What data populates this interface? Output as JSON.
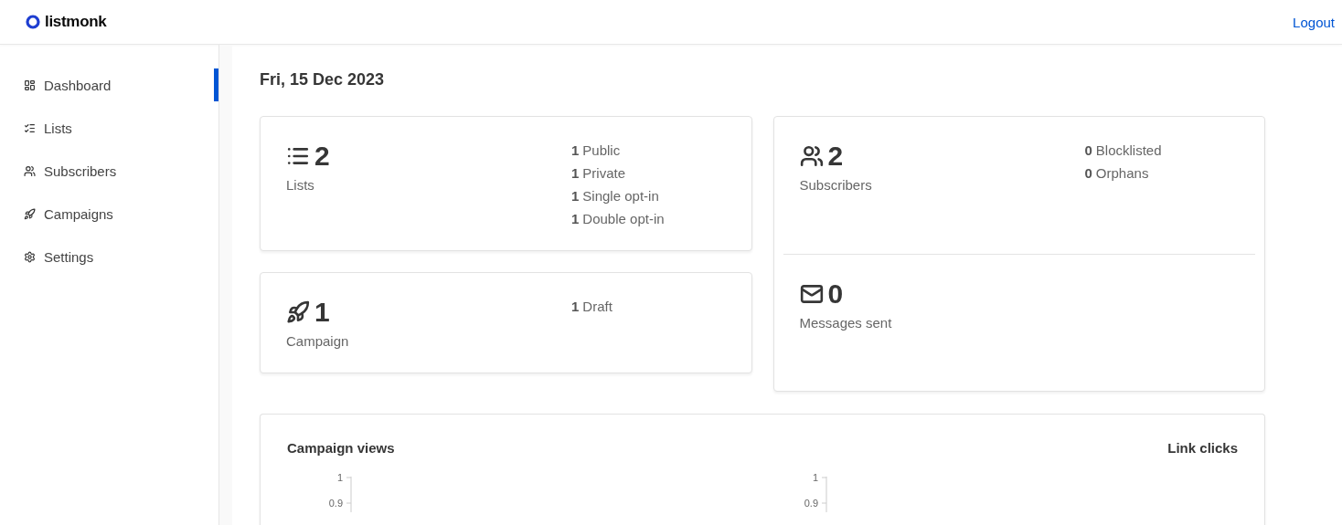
{
  "header": {
    "logo": "listmonk",
    "logout": "Logout"
  },
  "sidebar": {
    "items": [
      {
        "label": "Dashboard",
        "kind": "dashboard",
        "selected": true
      },
      {
        "label": "Lists",
        "kind": "lists",
        "selected": false
      },
      {
        "label": "Subscribers",
        "kind": "subscribers",
        "selected": false
      },
      {
        "label": "Campaigns",
        "kind": "campaigns",
        "selected": false
      },
      {
        "label": "Settings",
        "kind": "settings",
        "selected": false
      }
    ]
  },
  "date": "Fri, 15 Dec 2023",
  "columns": [
    [
      {
        "sections": [
          {
            "kind": "lists",
            "count": "2",
            "label": "Lists",
            "breakdown": [
              {
                "count": "1",
                "label": "Public"
              },
              {
                "count": "1",
                "label": "Private"
              },
              {
                "count": "1",
                "label": "Single opt-in"
              },
              {
                "count": "1",
                "label": "Double opt-in"
              }
            ]
          }
        ]
      },
      {
        "sections": [
          {
            "kind": "campaigns",
            "count": "1",
            "label": "Campaign",
            "breakdown": [
              {
                "count": "1",
                "label": "Draft"
              }
            ]
          }
        ]
      }
    ],
    [
      {
        "sections": [
          {
            "kind": "subscribers",
            "count": "2",
            "label": "Subscribers",
            "breakdown": [
              {
                "count": "0",
                "label": "Blocklisted"
              },
              {
                "count": "0",
                "label": "Orphans"
              }
            ]
          },
          {
            "kind": "messages",
            "count": "0",
            "label": "Messages sent"
          }
        ]
      }
    ]
  ],
  "charts": [
    {
      "title": "Campaign views",
      "axis_labels": [
        "1",
        "0.9"
      ]
    },
    {
      "title": "Link clicks",
      "axis_labels": [
        "1",
        "0.9"
      ]
    }
  ]
}
